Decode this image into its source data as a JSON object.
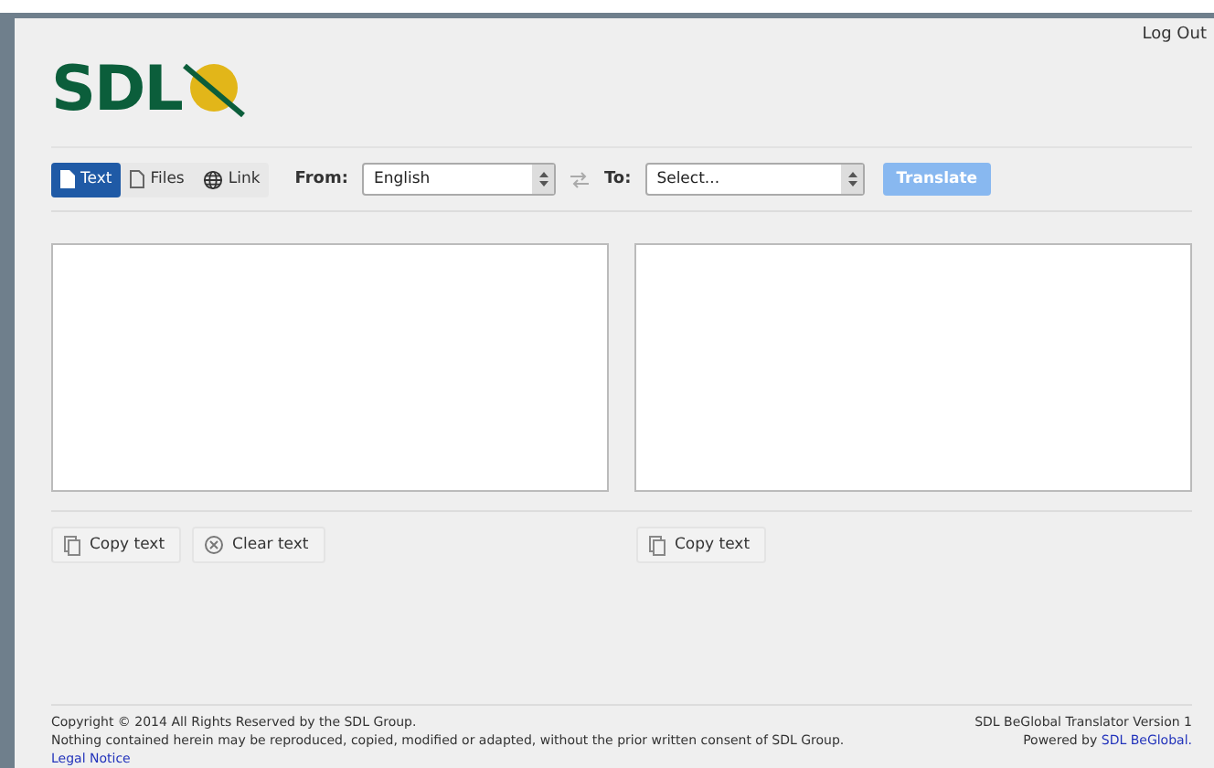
{
  "header": {
    "logo": "SDL",
    "logout": "Log Out"
  },
  "modes": [
    {
      "label": "Text",
      "kind": "doc",
      "selected": true
    },
    {
      "label": "Files",
      "kind": "file",
      "selected": false
    },
    {
      "label": "Link",
      "kind": "globe",
      "selected": false
    }
  ],
  "from": {
    "label": "From:",
    "value": "English"
  },
  "to": {
    "label": "To:",
    "value": "Select..."
  },
  "translate": {
    "label": "Translate",
    "disabled": true
  },
  "source_actions": [
    "Copy text",
    "Clear text"
  ],
  "target_actions": [
    "Copy text"
  ],
  "footer": {
    "copyright": "Copyright © 2014 All Rights Reserved by the SDL Group.",
    "notice": "Nothing contained herein may be reproduced, copied, modified or adapted, without the prior written consent of SDL Group.",
    "legal_link": "Legal Notice",
    "version": "SDL BeGlobal Translator Version 1",
    "powered_by": "Powered by",
    "powered_link": "SDL BeGlobal."
  }
}
